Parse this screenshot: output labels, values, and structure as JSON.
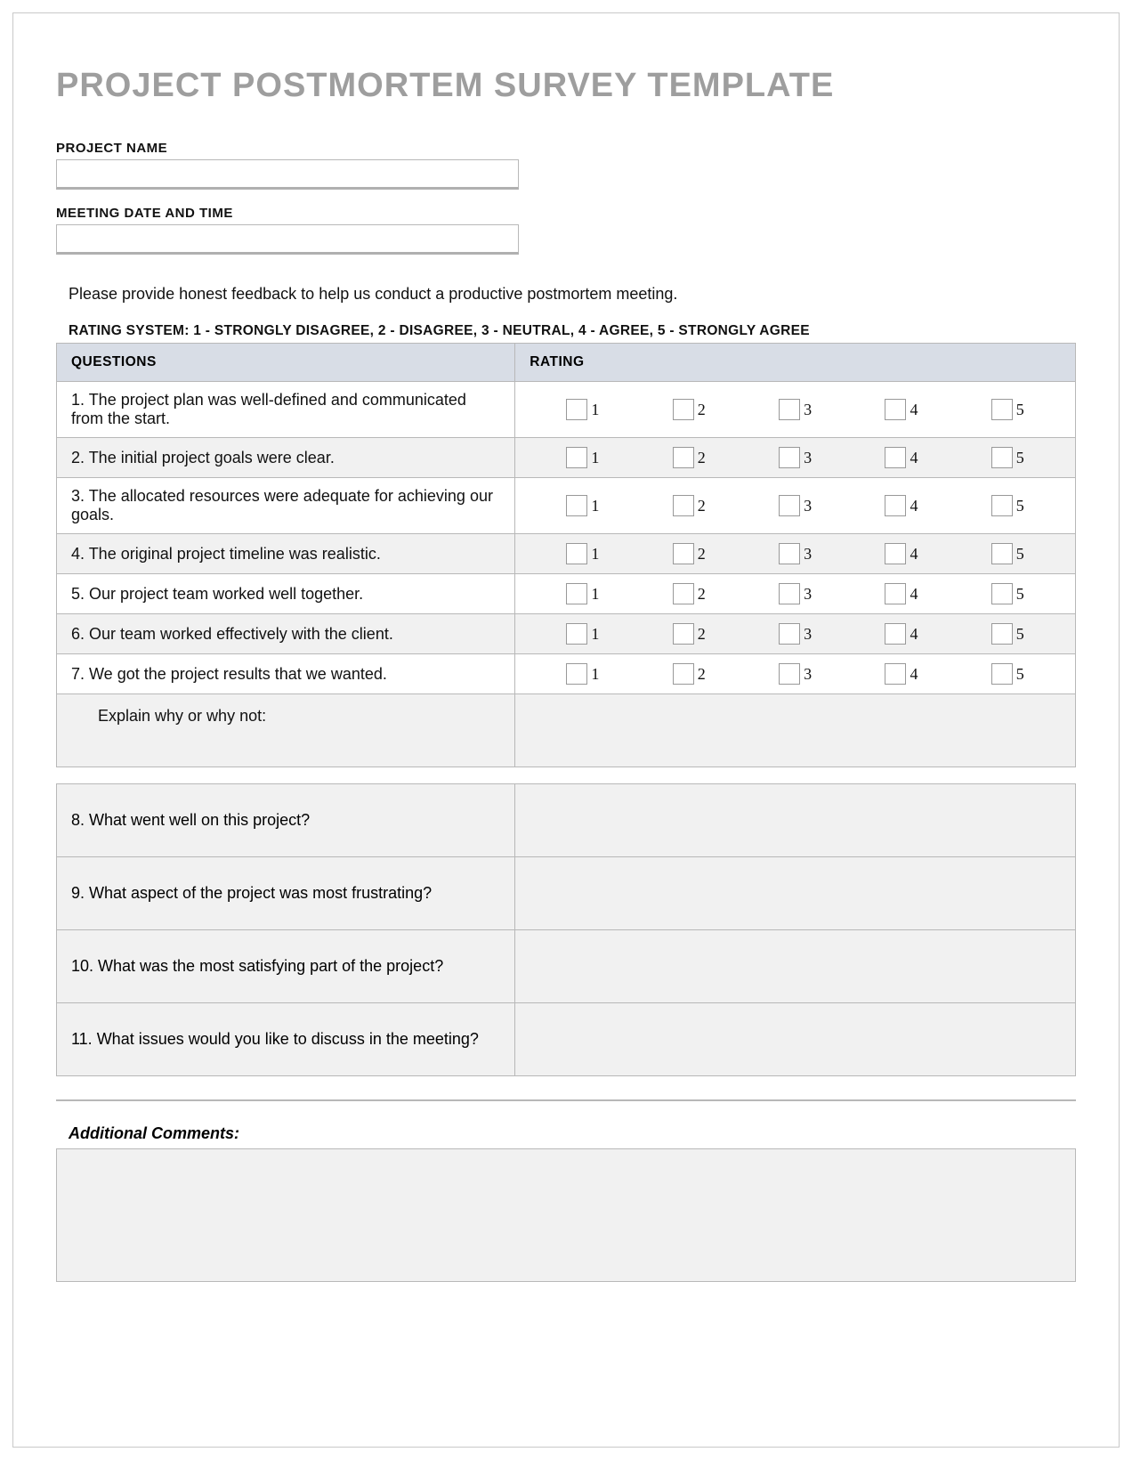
{
  "title": "PROJECT POSTMORTEM SURVEY TEMPLATE",
  "fields": {
    "project_name_label": "PROJECT NAME",
    "project_name_value": "",
    "meeting_label": "MEETING DATE AND TIME",
    "meeting_value": ""
  },
  "instructions": "Please provide honest feedback to help us conduct a productive postmortem meeting.",
  "rating_system": "RATING SYSTEM: 1 - STRONGLY DISAGREE, 2 - DISAGREE, 3 - NEUTRAL, 4 - AGREE, 5 - STRONGLY AGREE",
  "headers": {
    "questions": "QUESTIONS",
    "rating": "RATING"
  },
  "rating_labels": [
    "1",
    "2",
    "3",
    "4",
    "5"
  ],
  "questions": [
    "1. The project plan was well-defined and communicated from the start.",
    "2. The initial project goals were clear.",
    "3. The allocated resources were adequate for achieving our goals.",
    "4. The original project timeline was realistic.",
    "5. Our project team worked well together.",
    "6. Our team worked effectively with the client.",
    "7. We got the project results that we wanted."
  ],
  "explain_label": "Explain why or why not:",
  "open_questions": [
    "8. What went well on this project?",
    "9. What aspect of the project was most frustrating?",
    "10. What was the most satisfying part of the project?",
    "11. What issues would you like to discuss in the meeting?"
  ],
  "additional_label": "Additional Comments:"
}
